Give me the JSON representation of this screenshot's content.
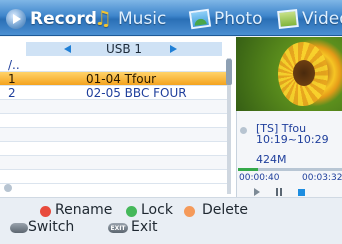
{
  "tabs": [
    {
      "label": "Record",
      "icon": "record-icon",
      "active": true
    },
    {
      "label": "Music",
      "icon": "music-icon",
      "active": false
    },
    {
      "label": "Photo",
      "icon": "photo-icon",
      "active": false
    },
    {
      "label": "Video",
      "icon": "video-icon",
      "active": false
    }
  ],
  "browser": {
    "device": "USB 1",
    "parent_dir": "/..",
    "files": [
      {
        "num": "1",
        "name": "01-04 Tfour",
        "selected": true
      },
      {
        "num": "2",
        "name": "02-05 BBC FOUR",
        "selected": false
      }
    ]
  },
  "preview": {
    "thumbnail": "sunflower-image",
    "channel": "[TS] Tfou",
    "time_range": "10:19~10:29",
    "size": "424M",
    "elapsed": "00:00:40",
    "duration": "00:03:32",
    "progress": 0.19
  },
  "help": {
    "rename": {
      "label": "Rename",
      "color": "#e84a3c"
    },
    "lock": {
      "label": "Lock",
      "color": "#45b85a"
    },
    "delete": {
      "label": "Delete",
      "color": "#f59a5a"
    },
    "switch": {
      "key": "",
      "label": "Switch"
    },
    "exit": {
      "key": "EXIT",
      "label": "Exit"
    }
  },
  "colors": {
    "accent": "#2a6fb6",
    "selection": "#f4a31f",
    "text": "#1f3f9c"
  }
}
